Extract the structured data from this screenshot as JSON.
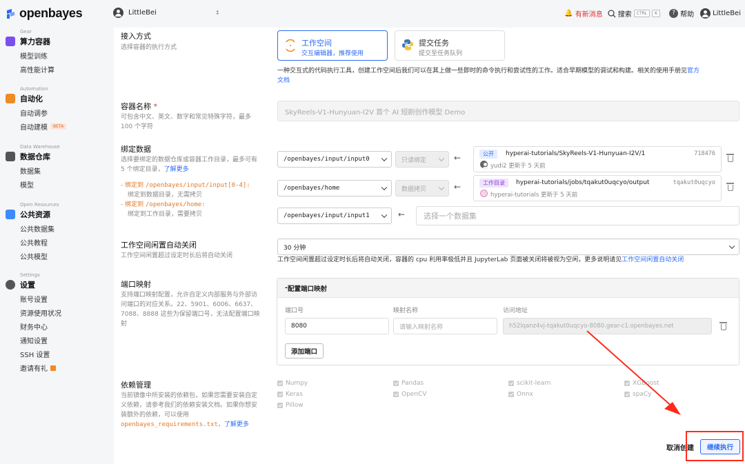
{
  "brand": {
    "name": "openbayes",
    "accent": "#2b6bf3"
  },
  "top": {
    "org": "LittleBei",
    "news": "有新消息",
    "search": "搜索",
    "kbd1": "CTRL",
    "kbd2": "K",
    "help": "帮助",
    "user": "LittleBei"
  },
  "sidebar": {
    "gear": {
      "small": "Gear",
      "title": "算力容器",
      "items": [
        "模型训练",
        "高性能计算"
      ]
    },
    "automation": {
      "small": "Automation",
      "title": "自动化",
      "items": [
        "自动调参",
        "自动建模"
      ],
      "beta": "BETA"
    },
    "warehouse": {
      "small": "Data Warehouse",
      "title": "数据仓库",
      "items": [
        "数据集",
        "模型"
      ]
    },
    "public": {
      "small": "Open Resources",
      "title": "公共资源",
      "items": [
        "公共数据集",
        "公共教程",
        "公共模型"
      ]
    },
    "settings": {
      "small": "Settings",
      "title": "设置",
      "items": [
        "账号设置",
        "资源使用状况",
        "财务中心",
        "通知设置",
        "SSH 设置",
        "邀请有礼"
      ]
    }
  },
  "access": {
    "label": "接入方式",
    "desc": "选择容器的执行方式",
    "workspace": {
      "title": "工作空间",
      "sub": "交互编辑器，推荐使用"
    },
    "task": {
      "title": "提交任务",
      "sub": "提交至任务队列"
    },
    "info": "一种交互式的代码执行工具，创建工作空间后我们可以在其上做一些即时的命令执行和尝试性的工作。适合早期模型的调试和构建。相关的使用手册见",
    "info_link1": "官方",
    "info_link2": "文档"
  },
  "name": {
    "label": "容器名称",
    "req": "*",
    "desc1": "可包含中文、英文、数字和常见特殊字符，最多",
    "desc2": "100 个字符",
    "value": "SkyReels-V1-Hunyuan-I2V 首个 AI 短剧创作模型 Demo"
  },
  "bind": {
    "label": "绑定数据",
    "desc1": "选择要绑定的数据仓库或容器工作目录，最多可有",
    "desc2": "5 个绑定目录，",
    "more": "了解更多",
    "note1a": "绑定到",
    "note1b": "/openbayes/input/input[0-4]:",
    "note1c": "绑定到数据目录，无需拷贝",
    "note2a": "绑定到",
    "note2b": "/openbayes/home:",
    "note2c": "绑定到工作目录，需要拷贝",
    "rows": [
      {
        "path": "/openbayes/input/input0",
        "mode": "只读绑定",
        "tag": "公开",
        "name": "hyperai-tutorials/SkyReels-V1-Hunyuan-I2V/1",
        "id": "718476",
        "owner": "yudi2",
        "updated": "更新于 5 天前"
      },
      {
        "path": "/openbayes/home",
        "mode": "数据拷贝",
        "tag": "工作目录",
        "name": "hyperai-tutorials/jobs/tqakut0uqcyo/output",
        "id": "tqakut0uqcyo",
        "owner": "hyperai-tutorials",
        "updated": "更新于 5 天前"
      },
      {
        "path": "/openbayes/input/input1",
        "placeholder": "选择一个数据集"
      }
    ]
  },
  "idle": {
    "label": "工作空间闲置自动关闭",
    "desc": "工作空间闲置超过设定时长后将自动关闭",
    "value": "30 分钟",
    "info": "工作空间闲置超过设定时长后将自动关闭，容器的 cpu 利用率极低并且 JupyterLab 页面被关闭将被视为空闲，更多说明请见",
    "info_link": "工作空间闲置自动关闭"
  },
  "port": {
    "label": "端口映射",
    "desc": [
      "支持端口映射配置，允许自定义内部服务与外部访",
      "问端口的对应关系。22、5901、6006、6637、",
      "7088、8888 这些为保留端口号，无法配置端口映",
      "射"
    ],
    "head": "配置端口映射",
    "col1": "端口号",
    "col2": "映射名称",
    "col3": "访问地址",
    "port": "8080",
    "name_placeholder": "请输入映射名称",
    "url": "h52lqanz4vj-tqakut0uqcyo-8080.gear-c1.openbayes.net",
    "add": "添加端口"
  },
  "deps": {
    "label": "依赖管理",
    "desc": [
      "当前镜像中所安装的依赖包，如果您需要安装自定",
      "义依赖，请参考我们的依赖安装文档。如果你想安",
      "装额外的依赖，可以使用"
    ],
    "file": "openbayes_requirements.txt",
    "more": "了解更多",
    "items": [
      "Numpy",
      "Pandas",
      "scikit-learn",
      "XGBoost",
      "Keras",
      "OpenCV",
      "Onnx",
      "spaCy",
      "Pillow"
    ]
  },
  "footer": {
    "cancel": "取消创建",
    "continue": "继续执行"
  },
  "colors": {
    "danger": "#e03131",
    "highlight": "#ff2a1a"
  }
}
